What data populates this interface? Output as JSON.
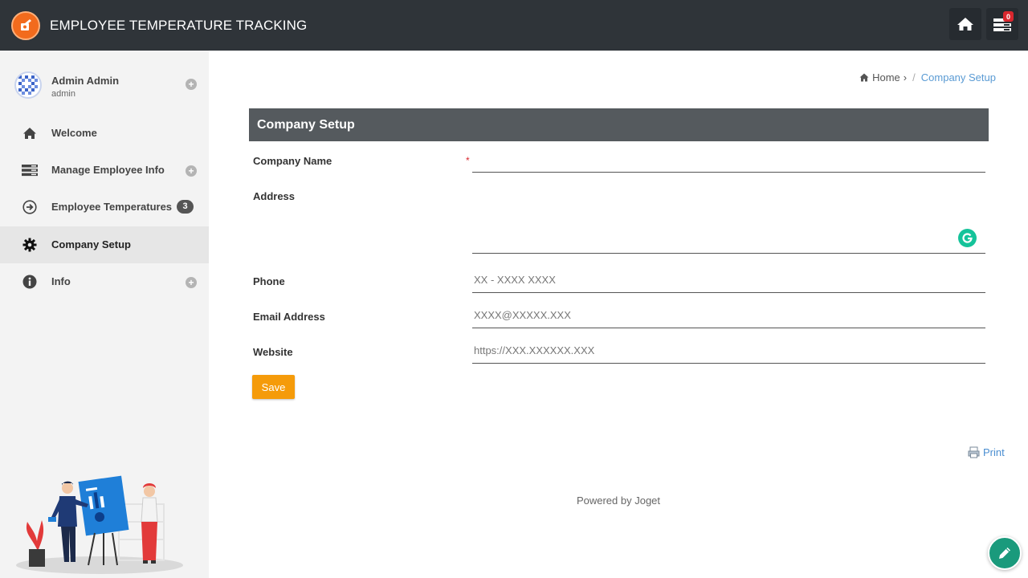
{
  "app": {
    "title": "EMPLOYEE TEMPERATURE TRACKING",
    "notification_count": "0"
  },
  "user": {
    "name": "Admin Admin",
    "role": "admin"
  },
  "sidebar": {
    "items": [
      {
        "label": "Welcome",
        "icon": "home-icon"
      },
      {
        "label": "Manage Employee Info",
        "icon": "list-icon"
      },
      {
        "label": "Employee Temperatures",
        "icon": "arrow-circle-icon",
        "count": "3"
      },
      {
        "label": "Company Setup",
        "icon": "gear-icon",
        "active": true
      },
      {
        "label": "Info",
        "icon": "info-icon"
      }
    ]
  },
  "breadcrumb": {
    "home": "Home",
    "current": "Company Setup"
  },
  "form": {
    "title": "Company Setup",
    "fields": {
      "company_name": {
        "label": "Company Name",
        "value": "",
        "required": "*"
      },
      "address": {
        "label": "Address",
        "value": ""
      },
      "phone": {
        "label": "Phone",
        "value": "XX - XXXX XXXX"
      },
      "email": {
        "label": "Email Address",
        "value": "XXXX@XXXXX.XXX"
      },
      "website": {
        "label": "Website",
        "value": "https://XXX.XXXXXX.XXX"
      }
    },
    "save_label": "Save"
  },
  "print_label": "Print",
  "footer": "Powered by Joget",
  "colors": {
    "topbar": "#2f3439",
    "accent": "#f59b0a",
    "link": "#5a9bd4",
    "fab": "#1a9a7c"
  }
}
